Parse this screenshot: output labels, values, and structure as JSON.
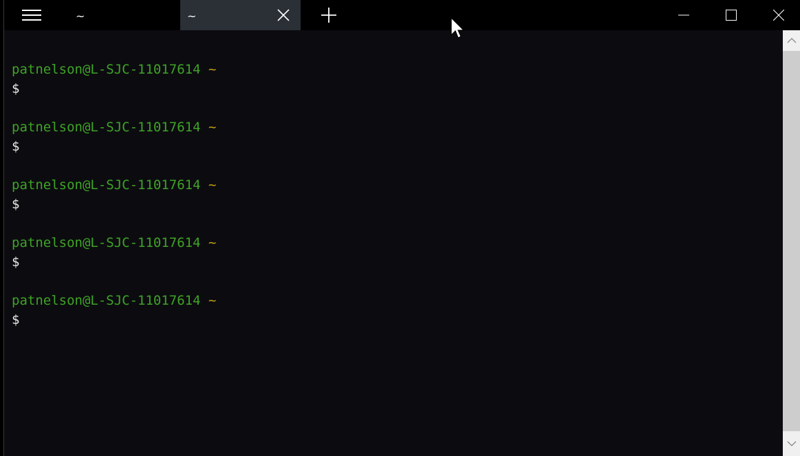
{
  "tabs": [
    {
      "title": "~",
      "active": false
    },
    {
      "title": "~",
      "active": true
    }
  ],
  "icons": {
    "menu": "hamburger-menu-icon",
    "tab_close": "close-icon",
    "new_tab": "plus-icon",
    "minimize": "minimize-icon",
    "maximize": "maximize-icon",
    "close": "close-icon",
    "scroll_up": "chevron-up-icon",
    "scroll_down": "chevron-down-icon",
    "pointer": "mouse-pointer-icon"
  },
  "colors": {
    "terminal_bg": "#0c0c10",
    "user_host": "#3fa327",
    "cwd": "#c6a10d",
    "text": "#e8e8e8",
    "active_tab_bg": "#2b2f36"
  },
  "terminal": {
    "prompts": [
      {
        "user_host": "patnelson@L-SJC-11017614",
        "cwd": "~",
        "symbol": "$"
      },
      {
        "user_host": "patnelson@L-SJC-11017614",
        "cwd": "~",
        "symbol": "$"
      },
      {
        "user_host": "patnelson@L-SJC-11017614",
        "cwd": "~",
        "symbol": "$"
      },
      {
        "user_host": "patnelson@L-SJC-11017614",
        "cwd": "~",
        "symbol": "$"
      },
      {
        "user_host": "patnelson@L-SJC-11017614",
        "cwd": "~",
        "symbol": "$"
      }
    ]
  }
}
